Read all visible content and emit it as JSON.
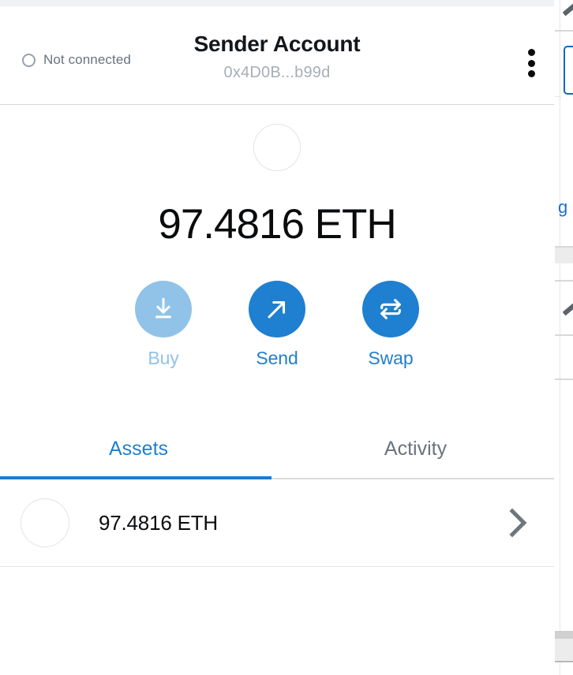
{
  "background": {
    "link_fragment": "g"
  },
  "wallet": {
    "header": {
      "connection_status": "Not connected",
      "account_name": "Sender Account",
      "account_address": "0x4D0B...b99d",
      "menu_icon": "kebab-menu-icon"
    },
    "balance": {
      "amount": "97.4816 ETH",
      "token_icon": "token-placeholder-icon"
    },
    "actions": [
      {
        "id": "buy",
        "label": "Buy",
        "icon": "download-arrow-icon",
        "enabled": false
      },
      {
        "id": "send",
        "label": "Send",
        "icon": "arrow-up-right-icon",
        "enabled": true
      },
      {
        "id": "swap",
        "label": "Swap",
        "icon": "swap-arrows-icon",
        "enabled": true
      }
    ],
    "tabs": [
      {
        "id": "assets",
        "label": "Assets",
        "active": true
      },
      {
        "id": "activity",
        "label": "Activity",
        "active": false
      }
    ],
    "assets": [
      {
        "label": "97.4816 ETH",
        "icon": "token-placeholder-icon",
        "chevron": "chevron-right-icon"
      }
    ]
  },
  "colors": {
    "accent_blue": "#1f7fd0",
    "accent_blue_disabled": "#91c3e8",
    "tab_underline": "#1a7bd0",
    "muted_text": "#6a737d",
    "address_text": "#a7aeb6"
  }
}
